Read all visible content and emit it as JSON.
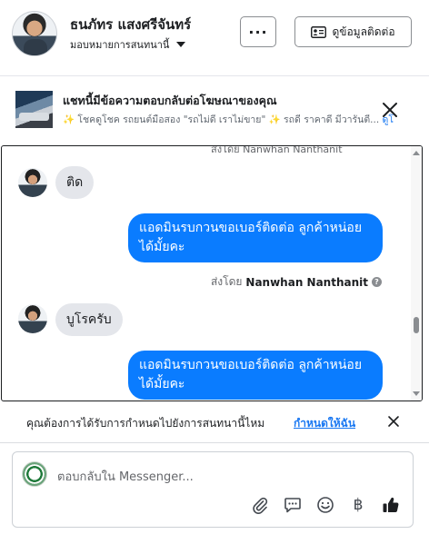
{
  "header": {
    "contact_name": "ธนภัทร แสงศรีจันทร์",
    "assign_label": "มอบหมายการสนทนานี้",
    "more_label": "···",
    "contact_info_label": "ดูข้อมูลติดต่อ"
  },
  "ad_banner": {
    "title": "แชทนี้มีข้อความตอบกลับต่อโฆษณาของคุณ",
    "subtitle_spark_1": "✨",
    "subtitle_text": " โชคดูโชค รถยนต์มือสอง \"รถไม่ดี เราไม่ขาย\" ",
    "subtitle_spark_2": "✨",
    "subtitle_tail": " รถดี ราคาดี มีวารันตี...",
    "more_link": "ดูโ"
  },
  "thread": {
    "clipped_top_text": "ส่งโดย Nanwhan Nanthanit",
    "messages": [
      {
        "direction": "in",
        "text": "ติด"
      },
      {
        "direction": "out",
        "text": "แอดมินรบกวนขอเบอร์ติดต่อ ลูกค้าหน่อยได้มั้ยคะ"
      },
      {
        "direction": "in",
        "text": "บูโรครับ"
      },
      {
        "direction": "out",
        "text": "แอดมินรบกวนขอเบอร์ติดต่อ ลูกค้าหน่อยได้มั้ยคะ"
      }
    ],
    "sent_by_prefix": "ส่งโดย",
    "sent_by_name": "Nanwhan Nanthanit",
    "help_glyph": "?"
  },
  "assign_prompt": {
    "question": "คุณต้องการได้รับการกำหนดไปยังการสนทนานี้ไหม",
    "action_link": "กำหนดให้ฉัน"
  },
  "composer": {
    "placeholder": "ตอบกลับใน Messenger...",
    "currency_glyph": "฿"
  },
  "colors": {
    "outgoing_bubble": "#0a7cff",
    "incoming_bubble": "#e4e6eb",
    "link": "#1877f2"
  },
  "icons": [
    "avatar",
    "chevron-down-icon",
    "contact-card-icon",
    "close-icon",
    "help-icon",
    "paperclip-icon",
    "saved-reply-icon",
    "emoji-icon",
    "baht-icon",
    "thumbs-up-icon"
  ]
}
